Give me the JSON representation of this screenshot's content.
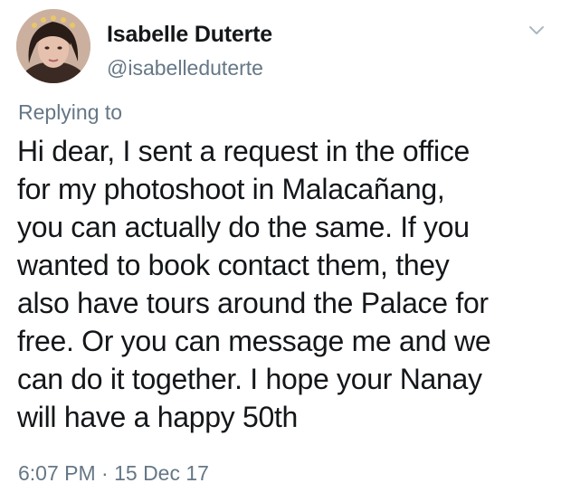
{
  "tweet": {
    "author": {
      "name": "Isabelle Duterte",
      "handle": "@isabelleduterte",
      "avatar_icon": "profile-photo"
    },
    "menu_icon": "chevron-down-icon",
    "replying_label": "Replying to",
    "text_lines": [
      "Hi dear, I sent a request in the office",
      "for my photoshoot in Malacañang,",
      "you can actually do the same. If you",
      "wanted to book  contact them, they",
      "also have tours around the Palace for",
      "free. Or you can message me and we",
      "can do it together. I hope your Nanay",
      "will have a happy 50th"
    ],
    "timestamp": "6:07 PM · 15 Dec 17"
  },
  "colors": {
    "text": "#14171a",
    "secondary": "#657786",
    "background": "#ffffff"
  }
}
